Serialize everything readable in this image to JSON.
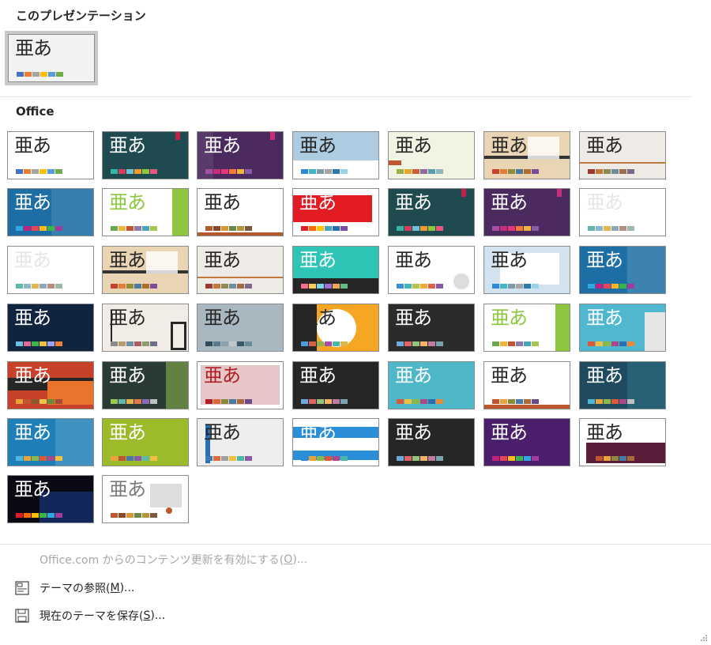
{
  "sections": {
    "current": "このプレゼンテーション",
    "office": "Office"
  },
  "glyph": "亜あ",
  "menu": {
    "update": {
      "pre": "Office.com からのコンテンツ更新を有効にする(",
      "key": "O",
      "post": ")..."
    },
    "browse": {
      "pre": "テーマの参照(",
      "key": "M",
      "post": ")..."
    },
    "save": {
      "pre": "現在のテーマを保存(",
      "key": "S",
      "post": ")..."
    }
  },
  "icons": {
    "browse": "browse-theme-icon",
    "save": "save-theme-icon",
    "grip": "resize-grip-icon"
  },
  "current_theme": {
    "bg": "#f2f2f2",
    "text": "#262626",
    "swatches": [
      "#4472c4",
      "#ed7d31",
      "#a5a5a5",
      "#ffc000",
      "#5b9bd5",
      "#70ad47"
    ]
  },
  "office_themes": [
    {
      "bg": "#ffffff",
      "text": "#262626",
      "sw": [
        "#4472c4",
        "#ed7d31",
        "#a5a5a5",
        "#ffc000",
        "#5b9bd5",
        "#70ad47"
      ]
    },
    {
      "bg": "#1f4a4f",
      "text": "#ffffff",
      "sw": [
        "#31b6a8",
        "#d83c5c",
        "#6ec2d4",
        "#f59b2b",
        "#8dc63f",
        "#e8577d"
      ]
    },
    {
      "bg": "#4b2b5f",
      "text": "#ffffff",
      "sw": [
        "#a84fa4",
        "#c62f7a",
        "#e4367b",
        "#f47a3b",
        "#efb43b",
        "#8b5aa8"
      ]
    },
    {
      "bg": "#ffffff",
      "text": "#262626",
      "sw": [
        "#2d8bd5",
        "#3fb6c6",
        "#7e9aa8",
        "#a5a5a5",
        "#2e79a8",
        "#9ad2e6"
      ]
    },
    {
      "bg": "#f1f3e3",
      "text": "#262626",
      "sw": [
        "#9bb046",
        "#e5a52d",
        "#cf5f3b",
        "#8f6c9f",
        "#5a9dad",
        "#8ab7bd"
      ]
    },
    {
      "bg": "#e9d5b4",
      "text": "#262626",
      "sw": [
        "#c3432e",
        "#e37d37",
        "#8d8d3a",
        "#4d7aa3",
        "#b16d2d",
        "#7c4c9b"
      ]
    },
    {
      "bg": "#eeeae6",
      "text": "#262626",
      "sw": [
        "#9b3a30",
        "#c27a3b",
        "#8d8a55",
        "#6e8e9b",
        "#a06a4c",
        "#7c6a8a"
      ]
    },
    {
      "bg": "#1c6ea4",
      "text": "#ffffff",
      "sw": [
        "#2fa8e0",
        "#c0227f",
        "#e8445a",
        "#ffb81c",
        "#3ab54a",
        "#a23b9b"
      ]
    },
    {
      "bg": "#ffffff",
      "text": "#8dc63f",
      "sw": [
        "#6aa84f",
        "#efb43b",
        "#c0562f",
        "#8d7aa8",
        "#4aa3b8",
        "#a5c64f"
      ]
    },
    {
      "bg": "#ffffff",
      "text": "#262626",
      "sw": [
        "#b35a2c",
        "#8c4a2c",
        "#d8963b",
        "#6b8a4a",
        "#b8943b",
        "#7c5a3b"
      ]
    },
    {
      "bg": "#ffffff",
      "text": "#ffffff",
      "sw": [
        "#e31b23",
        "#ff6a00",
        "#ffc000",
        "#4aa3b8",
        "#2a6eb2",
        "#7a4ea8"
      ]
    },
    {
      "bg": "#1f4a4f",
      "text": "#ffffff",
      "sw": [
        "#31b6a8",
        "#d83c5c",
        "#6ec2d4",
        "#f59b2b",
        "#8dc63f",
        "#e8577d"
      ]
    },
    {
      "bg": "#4b2b5f",
      "text": "#ffffff",
      "sw": [
        "#a84fa4",
        "#c62f7a",
        "#e4367b",
        "#f47a3b",
        "#efb43b",
        "#8b5aa8"
      ]
    },
    {
      "bg": "#ffffff",
      "text": "#e6e6e6",
      "sw": [
        "#5fb9a8",
        "#8bb8c7",
        "#e2b44b",
        "#8fa8b7",
        "#b48f7b",
        "#9bb8a8"
      ]
    },
    {
      "bg": "#ffffff",
      "text": "#e6e6e6",
      "sw": [
        "#5fb9a8",
        "#8bb8c7",
        "#e2b44b",
        "#8fa8b7",
        "#b48f7b",
        "#9bb8a8"
      ]
    },
    {
      "bg": "#e9d5b4",
      "text": "#262626",
      "sw": [
        "#c3432e",
        "#e37d37",
        "#8d8d3a",
        "#4d7aa3",
        "#b16d2d",
        "#7c4c9b"
      ]
    },
    {
      "bg": "#eeeae6",
      "text": "#262626",
      "sw": [
        "#9b3a30",
        "#c27a3b",
        "#8d8a55",
        "#6e8e9b",
        "#a06a4c",
        "#7c6a8a"
      ]
    },
    {
      "bg": "#2ec4b6",
      "text": "#ffffff",
      "sw": [
        "#f76f8e",
        "#ffc857",
        "#7dd3e8",
        "#a06cd5",
        "#f2a65a",
        "#5fbf7f"
      ]
    },
    {
      "bg": "#ffffff",
      "text": "#262626",
      "sw": [
        "#3a8fd4",
        "#3fb8b6",
        "#b8c34a",
        "#f0a830",
        "#e0624b",
        "#8a5aa8"
      ]
    },
    {
      "bg": "#ffffff",
      "text": "#262626",
      "sw": [
        "#2d8bd5",
        "#3fb6c6",
        "#7e9aa8",
        "#a5a5a5",
        "#2e79a8",
        "#9ad2e6"
      ]
    },
    {
      "bg": "#1c6ea4",
      "text": "#ffffff",
      "sw": [
        "#2fa8e0",
        "#c0227f",
        "#e8445a",
        "#ffb81c",
        "#3ab54a",
        "#a23b9b"
      ]
    },
    {
      "bg": "#10233f",
      "text": "#ffffff",
      "sw": [
        "#6fbfe0",
        "#e06a91",
        "#3ab54a",
        "#f0c040",
        "#a0a0ff",
        "#f07f3a"
      ]
    },
    {
      "bg": "#f1ece6",
      "text": "#262626",
      "sw": [
        "#8a8a8a",
        "#b89b6a",
        "#6f8fa8",
        "#a85f5f",
        "#8a9f6a",
        "#6f6f8a"
      ]
    },
    {
      "bg": "#a9b7c0",
      "text": "#262626",
      "sw": [
        "#2f4a5a",
        "#5a7a8a",
        "#8aa0aa",
        "#c0c8cc",
        "#3a5a6a",
        "#6a8a9a"
      ]
    },
    {
      "bg": "#f5a623",
      "text": "#262626",
      "sw": [
        "#4a9fd8",
        "#d8604a",
        "#8ab84a",
        "#a84aa8",
        "#4ab8a8",
        "#d8b84a"
      ]
    },
    {
      "bg": "#2b2b2b",
      "text": "#ffffff",
      "sw": [
        "#6fa8dc",
        "#e06666",
        "#93c47d",
        "#f6b26b",
        "#c27ba0",
        "#76a5af"
      ]
    },
    {
      "bg": "#ffffff",
      "text": "#8dc63f",
      "sw": [
        "#6aa84f",
        "#efb43b",
        "#c0562f",
        "#8d7aa8",
        "#4aa3b8",
        "#a5c64f"
      ]
    },
    {
      "bg": "#4fb8d0",
      "text": "#ffffff",
      "sw": [
        "#d85a3a",
        "#f0c040",
        "#8ab84a",
        "#a84a8a",
        "#2a6eb2",
        "#e88a3a"
      ]
    },
    {
      "bg": "#c8412b",
      "text": "#ffffff",
      "sw": [
        "#e8a33a",
        "#c0562f",
        "#8a5a2b",
        "#e8c44a",
        "#6a8a3a",
        "#a84a3a"
      ]
    },
    {
      "bg": "#2a3a34",
      "text": "#ffffff",
      "sw": [
        "#9bc850",
        "#5fb9a8",
        "#e2b44b",
        "#e07a4a",
        "#8a6ab8",
        "#c0c0c0"
      ]
    },
    {
      "bg": "#ffffff",
      "text": "#b01e23",
      "sw": [
        "#b01e23",
        "#d86a3a",
        "#8a8a3a",
        "#4a7aa3",
        "#a86a3a",
        "#6a4a8a"
      ]
    },
    {
      "bg": "#262626",
      "text": "#ffffff",
      "sw": [
        "#6fa8dc",
        "#e06666",
        "#93c47d",
        "#f6b26b",
        "#c27ba0",
        "#76a5af"
      ]
    },
    {
      "bg": "#4fb8c8",
      "text": "#ffffff",
      "sw": [
        "#d85a3a",
        "#f0c040",
        "#8ab84a",
        "#a84a8a",
        "#2a6eb2",
        "#e88a3a"
      ]
    },
    {
      "bg": "#ffffff",
      "text": "#262626",
      "sw": [
        "#c0562f",
        "#e8a33a",
        "#8a8a3a",
        "#4a7aa3",
        "#a86a3a",
        "#6a4a8a"
      ]
    },
    {
      "bg": "#1f4a5f",
      "text": "#ffffff",
      "sw": [
        "#4fb8d0",
        "#e8a33a",
        "#8ab84a",
        "#d85a3a",
        "#a84a8a",
        "#c0c0c0"
      ]
    },
    {
      "bg": "#1f7fb8",
      "text": "#ffffff",
      "sw": [
        "#4fb8e0",
        "#e8a33a",
        "#8ab84a",
        "#d85a3a",
        "#a84a8a",
        "#f0c040"
      ]
    },
    {
      "bg": "#9bbb2b",
      "text": "#ffffff",
      "sw": [
        "#e8a33a",
        "#c0562f",
        "#4a7aa3",
        "#8a5aa8",
        "#5fb9a8",
        "#f0c040"
      ]
    },
    {
      "bg": "#eeeeee",
      "text": "#262626",
      "sw": [
        "#3a7ab8",
        "#e06a3a",
        "#a0a0a0",
        "#f0c040",
        "#4ab8a8",
        "#8a5aa8"
      ]
    },
    {
      "bg": "#ffffff",
      "text": "#ffffff",
      "sw": [
        "#2a8fd8",
        "#e8a33a",
        "#8ab84a",
        "#d85a3a",
        "#a84a8a",
        "#4ab8a8"
      ]
    },
    {
      "bg": "#262626",
      "text": "#ffffff",
      "sw": [
        "#6fa8dc",
        "#e06666",
        "#93c47d",
        "#f6b26b",
        "#c27ba0",
        "#76a5af"
      ]
    },
    {
      "bg": "#4b1e6b",
      "text": "#ffffff",
      "sw": [
        "#c0227f",
        "#e8445a",
        "#ffb81c",
        "#3ab54a",
        "#2fa8e0",
        "#a23b9b"
      ]
    },
    {
      "bg": "#ffffff",
      "text": "#262626",
      "sw": [
        "#5a1e3a",
        "#c0562f",
        "#e8a33a",
        "#8a8a3a",
        "#4a7aa3",
        "#a86a3a"
      ]
    },
    {
      "bg": "#0a0a14",
      "text": "#ffffff",
      "sw": [
        "#e31b23",
        "#ff6a00",
        "#ffc000",
        "#3ab54a",
        "#2fa8e0",
        "#a23b9b"
      ]
    },
    {
      "bg": "#ffffff",
      "text": "#7a7a7a",
      "sw": [
        "#c0562f",
        "#8a4a2c",
        "#d8963b",
        "#6b8a4a",
        "#b8943b",
        "#7c5a3b"
      ]
    }
  ]
}
